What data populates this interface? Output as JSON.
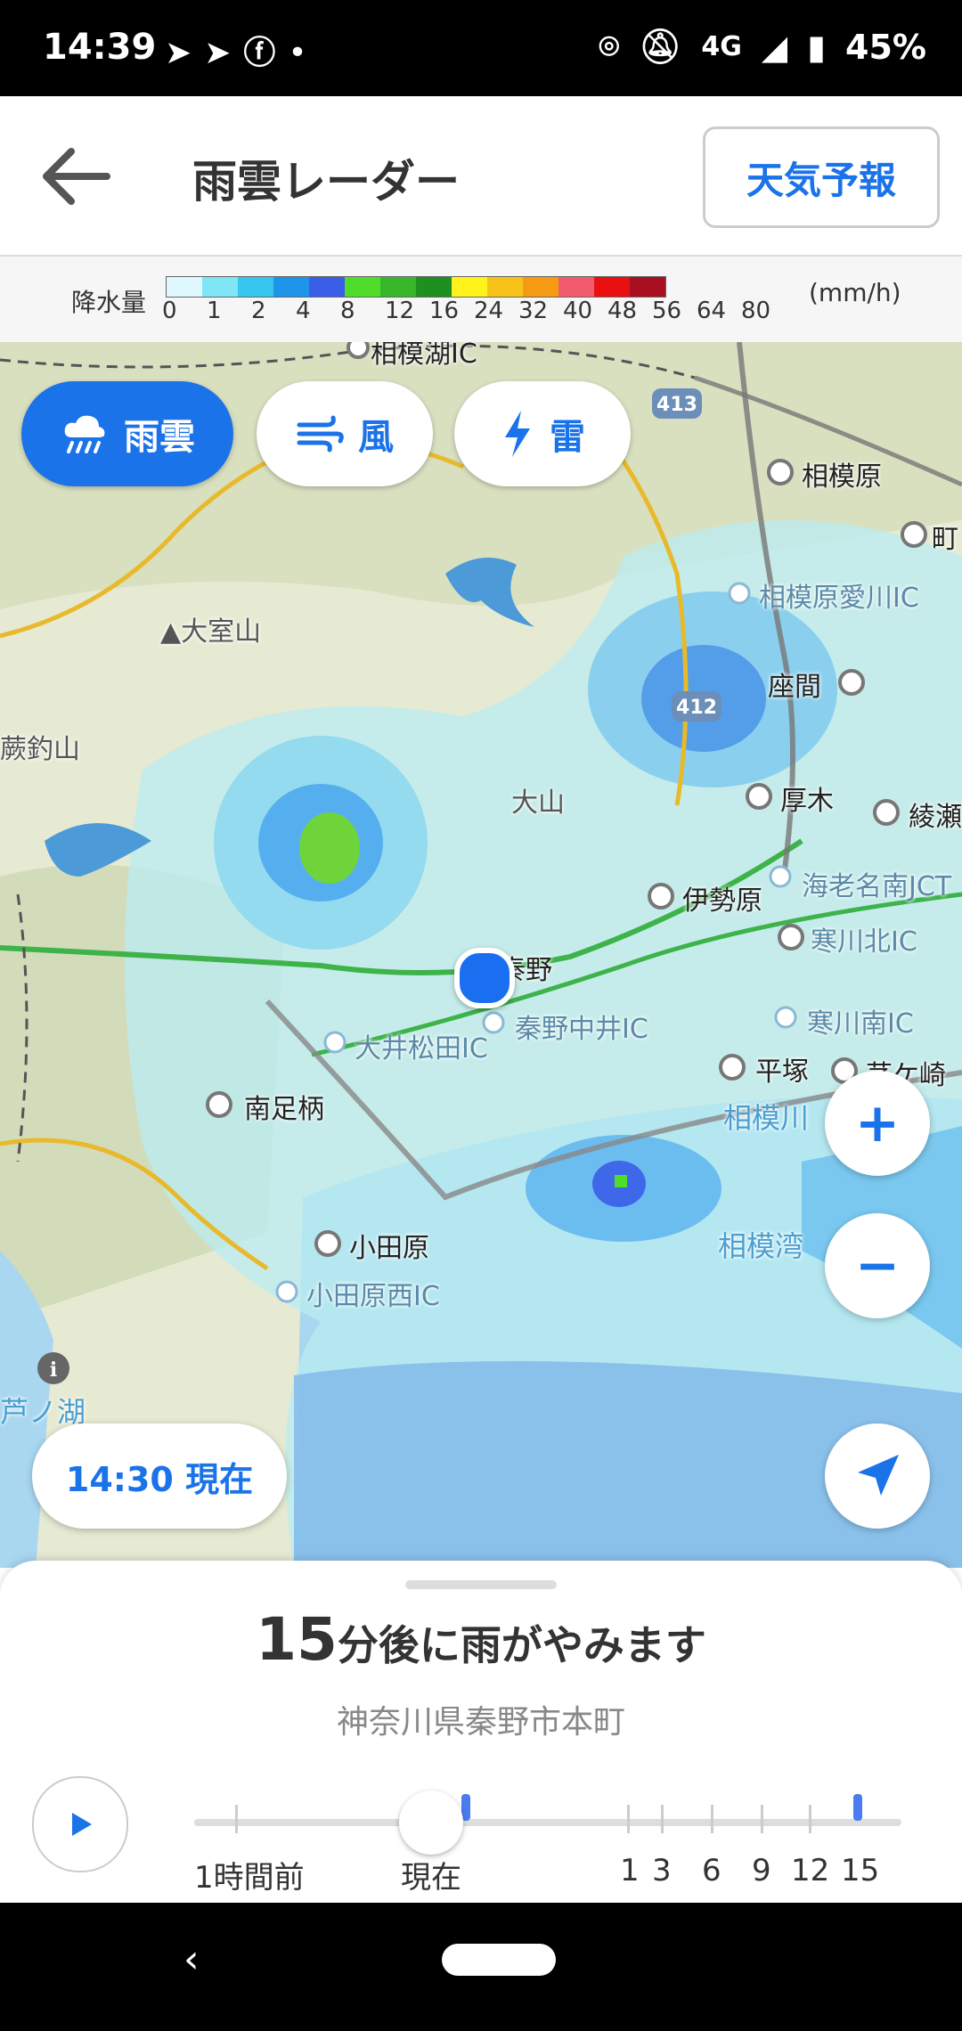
{
  "status_bar": {
    "time": "14:39",
    "network": "4G",
    "battery": "45%",
    "icons": [
      "paper-plane-icon",
      "paper-plane-icon",
      "facebook-icon",
      "dot-icon",
      "location-icon",
      "bell-off-icon",
      "signal-icon",
      "battery-icon"
    ]
  },
  "header": {
    "title": "雨雲レーダー",
    "forecast_button": "天気予報"
  },
  "legend": {
    "label": "降水量",
    "unit": "(mm/h)",
    "ticks": [
      "0",
      "1",
      "2",
      "4",
      "8",
      "12",
      "16",
      "24",
      "32",
      "40",
      "48",
      "56",
      "64",
      "80"
    ],
    "colors": [
      "#dff8ff",
      "#7fe6f5",
      "#36c5ee",
      "#1e95ea",
      "#3a5ee8",
      "#4fdc2a",
      "#38b72a",
      "#1f8f1f",
      "#fff21a",
      "#f7c318",
      "#f59a12",
      "#f25b6e",
      "#e81010",
      "#a80f20"
    ]
  },
  "layers": [
    {
      "label": "雨雲",
      "icon": "rain-cloud-icon",
      "active": true
    },
    {
      "label": "風",
      "icon": "wind-icon",
      "active": false
    },
    {
      "label": "雷",
      "icon": "lightning-icon",
      "active": false
    }
  ],
  "map": {
    "places": [
      {
        "name": "相模湖IC",
        "type": "ic"
      },
      {
        "name": "相模原",
        "type": "city"
      },
      {
        "name": "町",
        "type": "city"
      },
      {
        "name": "相模原愛川IC",
        "type": "ic"
      },
      {
        "name": "大室山",
        "type": "mtn"
      },
      {
        "name": "座間",
        "type": "city"
      },
      {
        "name": "蕨釣山",
        "type": "mtn"
      },
      {
        "name": "大山",
        "type": "mtn"
      },
      {
        "name": "厚木",
        "type": "city"
      },
      {
        "name": "綾瀬",
        "type": "city"
      },
      {
        "name": "海老名南JCT",
        "type": "ic"
      },
      {
        "name": "伊勢原",
        "type": "city"
      },
      {
        "name": "寒川北IC",
        "type": "ic"
      },
      {
        "name": "秦野",
        "type": "city"
      },
      {
        "name": "秦野中井IC",
        "type": "ic"
      },
      {
        "name": "大井松田IC",
        "type": "ic"
      },
      {
        "name": "寒川南IC",
        "type": "ic"
      },
      {
        "name": "平塚",
        "type": "city"
      },
      {
        "name": "茅ケ崎",
        "type": "city"
      },
      {
        "name": "南足柄",
        "type": "city"
      },
      {
        "name": "相模川",
        "type": "sea"
      },
      {
        "name": "小田原",
        "type": "city"
      },
      {
        "name": "相模湾",
        "type": "sea"
      },
      {
        "name": "小田原西IC",
        "type": "ic"
      },
      {
        "name": "芦ノ湖",
        "type": "sea"
      }
    ],
    "road_badges": [
      "413",
      "412"
    ],
    "zoom_in": "+",
    "zoom_out": "−",
    "current_time_label": "14:30 現在"
  },
  "sheet": {
    "minutes": "15",
    "message": "分後に雨がやみます",
    "address": "神奈川県秦野市本町"
  },
  "timeline": {
    "labels": [
      "1時間前",
      "現在",
      "1",
      "3",
      "6",
      "9",
      "12",
      "15"
    ]
  }
}
